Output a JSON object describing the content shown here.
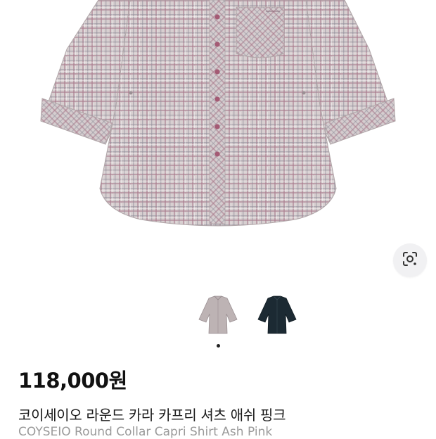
{
  "product": {
    "price": "118,000원",
    "title_ko": "코이세이오 라운드 카라 카프리 셔츠 애쉬 핑크",
    "title_en": "COYSEIO Round Collar Capri Shirt Ash Pink"
  },
  "gallery": {
    "image_search_icon": "lens-search-icon",
    "thumbnails": [
      {
        "color_name": "ash-pink",
        "color": "#b9aeb0"
      },
      {
        "color_name": "navy",
        "color": "#1c2a33"
      }
    ],
    "active_index": 0,
    "dot_count": 1
  },
  "colors": {
    "shirt_base": "#c9bfc0",
    "check_pink": "#a7788a",
    "check_gray": "#9b9aa2",
    "button": "#a45a74"
  }
}
